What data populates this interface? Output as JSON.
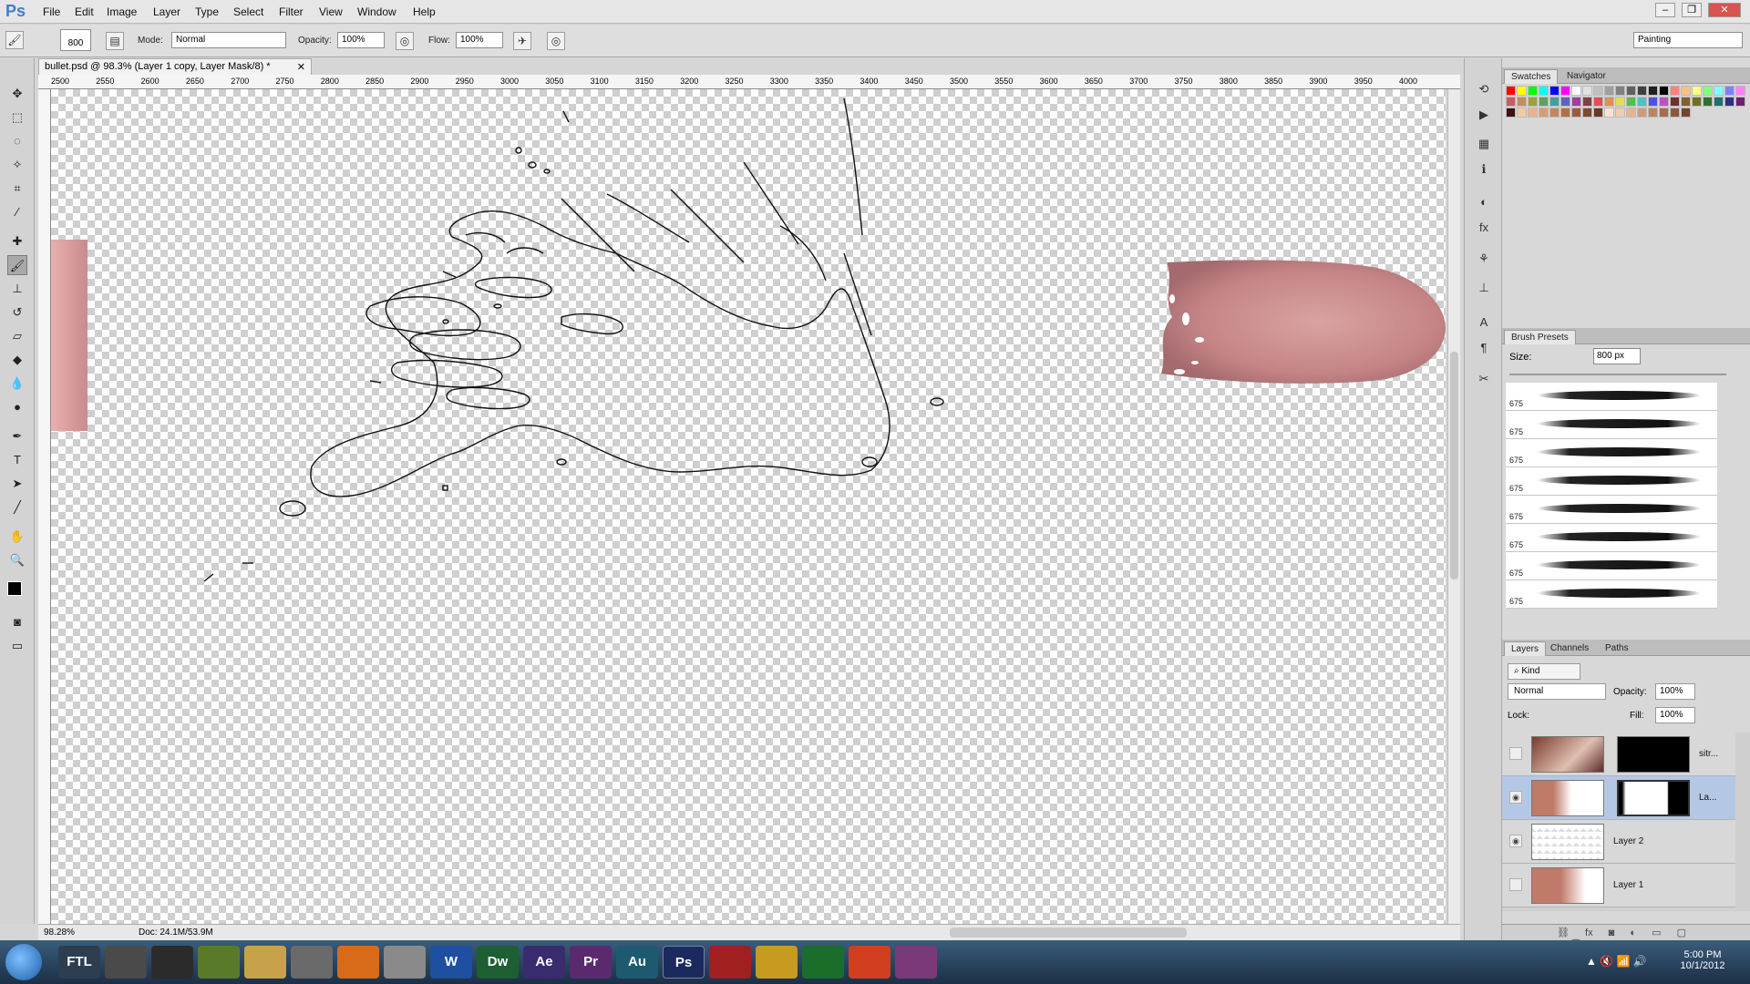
{
  "app": {
    "logo": "Ps",
    "menu": [
      "File",
      "Edit",
      "Image",
      "Layer",
      "Type",
      "Select",
      "Filter",
      "View",
      "Window",
      "Help"
    ],
    "workspace": "Painting"
  },
  "options_bar": {
    "brush_size": "800",
    "mode_label": "Mode:",
    "mode_value": "Normal",
    "opacity_label": "Opacity:",
    "opacity_value": "100%",
    "flow_label": "Flow:",
    "flow_value": "100%"
  },
  "document": {
    "tab_title": "bullet.psd @ 98.3% (Layer 1 copy, Layer Mask/8) *",
    "ruler_ticks": [
      "2500",
      "2550",
      "2600",
      "2650",
      "2700",
      "2750",
      "2800",
      "2850",
      "2900",
      "2950",
      "3000",
      "3050",
      "3100",
      "3150",
      "3200",
      "3250",
      "3300",
      "3350",
      "3400",
      "3450",
      "3500",
      "3550",
      "3600",
      "3650",
      "3700",
      "3750",
      "3800",
      "3850",
      "3900",
      "3950",
      "4000"
    ],
    "zoom": "98.28%",
    "doc_size": "Doc: 24.1M/53.9M"
  },
  "swatches_panel": {
    "tabs": [
      "Swatches",
      "Navigator"
    ],
    "colors": [
      "#ff0000",
      "#ffff00",
      "#00ff00",
      "#00ffff",
      "#0000ff",
      "#ff00ff",
      "#ffffff",
      "#e0e0e0",
      "#c0c0c0",
      "#a0a0a0",
      "#808080",
      "#606060",
      "#404040",
      "#202020",
      "#000000",
      "#ff8080",
      "#ffc080",
      "#ffff80",
      "#80ff80",
      "#80ffff",
      "#8080ff",
      "#ff80ff",
      "#c06060",
      "#c09060",
      "#a0a040",
      "#60a060",
      "#40a0a0",
      "#6060c0",
      "#a040a0",
      "#804040",
      "#e05050",
      "#e09050",
      "#e0e050",
      "#50c050",
      "#50c0c0",
      "#5050e0",
      "#c050c0",
      "#703030",
      "#806030",
      "#707020",
      "#307030",
      "#207070",
      "#303080",
      "#702070",
      "#401010",
      "#f4c9a8",
      "#e8b48e",
      "#d99d74",
      "#c6865c",
      "#b07048",
      "#985c3a",
      "#7e4a2e",
      "#663a24",
      "#fde3cf",
      "#f0cdb0",
      "#e2b592",
      "#d09c78",
      "#bb8461",
      "#a46d4e",
      "#8b583d",
      "#73472f"
    ]
  },
  "brush_presets": {
    "title": "Brush Presets",
    "size_label": "Size:",
    "size_value": "800 px",
    "brushes": [
      "675",
      "675",
      "675",
      "675",
      "675",
      "675",
      "675",
      "675"
    ]
  },
  "layers_panel": {
    "tabs": [
      "Layers",
      "Channels",
      "Paths"
    ],
    "kind_label": "Kind",
    "blend_mode": "Normal",
    "opacity_label": "Opacity:",
    "opacity_value": "100%",
    "lock_label": "Lock:",
    "fill_label": "Fill:",
    "fill_value": "100%",
    "layers": [
      {
        "name": "sitr..."
      },
      {
        "name": "La..."
      },
      {
        "name": "Layer 2"
      },
      {
        "name": "Layer 1"
      }
    ]
  },
  "taskbar": {
    "apps": [
      "FTL",
      "",
      "",
      "",
      "",
      "",
      "",
      "",
      "W",
      "Dw",
      "Ae",
      "Pr",
      "Au",
      "Ps",
      "",
      "",
      "",
      "",
      ""
    ],
    "time": "5:00 PM",
    "date": "10/1/2012"
  }
}
